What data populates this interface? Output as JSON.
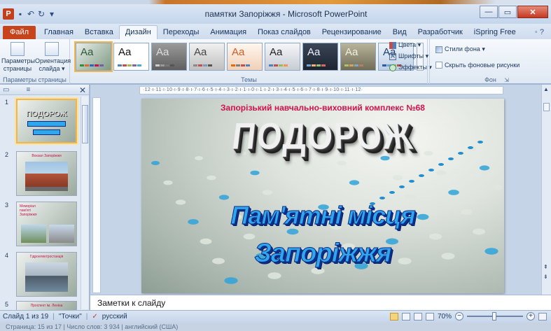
{
  "window": {
    "title": "памятки Запоріжжя - Microsoft PowerPoint",
    "app_glyph": "P"
  },
  "tabs": [
    {
      "label": "Файл"
    },
    {
      "label": "Главная"
    },
    {
      "label": "Вставка"
    },
    {
      "label": "Дизайн"
    },
    {
      "label": "Переходы"
    },
    {
      "label": "Анимация"
    },
    {
      "label": "Показ слайдов"
    },
    {
      "label": "Рецензирование"
    },
    {
      "label": "Вид"
    },
    {
      "label": "Разработчик"
    },
    {
      "label": "iSpring Free"
    }
  ],
  "ribbon": {
    "page_setup": {
      "params_label": "Параметры страницы",
      "orientation_label": "Ориентация слайда ▾",
      "group_label": "Параметры страницы"
    },
    "themes": {
      "sample": "Aa",
      "group_label": "Темы"
    },
    "theme_options": {
      "colors": "Цвета ▾",
      "fonts": "Шрифты ▾",
      "effects": "Эффекты ▾"
    },
    "background": {
      "styles": "Стили фона ▾",
      "hide_graphics": "Скрыть фоновые рисунки",
      "group_label": "Фон"
    }
  },
  "slides_pane": {
    "thumbs": [
      {
        "num": "1",
        "caption": "ПОДОРОЖ",
        "selected": true
      },
      {
        "num": "2",
        "caption": "Вокзал Запоріжжя"
      },
      {
        "num": "3",
        "caption": "Меморіал пам'яті Запоріжжя"
      },
      {
        "num": "4",
        "caption": "Гідроелектростанція"
      },
      {
        "num": "5",
        "caption": "Проспект ім. Леніна"
      }
    ]
  },
  "ruler": {
    "text": "·12·ı·11·ı·10·ı·9·ı·8·ı·7·ı·6·ı·5·ı·4·ı·3·ı·2·ı·1·ı·0·ı·1·ı·2·ı·3·ı·4·ı·5·ı·6·ı·7·ı·8·ı·9·ı·10·ı·11·ı·12·"
  },
  "slide": {
    "school": "Запорізький навчально-виховний комплекс №68",
    "word1": "ПОДОРОЖ",
    "word2": "Пам'ятні місця",
    "word3": "Запоріжжя"
  },
  "notes": {
    "placeholder": "Заметки к слайду"
  },
  "status": {
    "slide_info": "Слайд 1 из 19",
    "theme": "\"Точки\"",
    "language": "русский",
    "zoom": "70%"
  },
  "bottom_strip": {
    "text": "Страница: 15 из 17   |   Число слов: 3 934   |   английский (США)"
  }
}
